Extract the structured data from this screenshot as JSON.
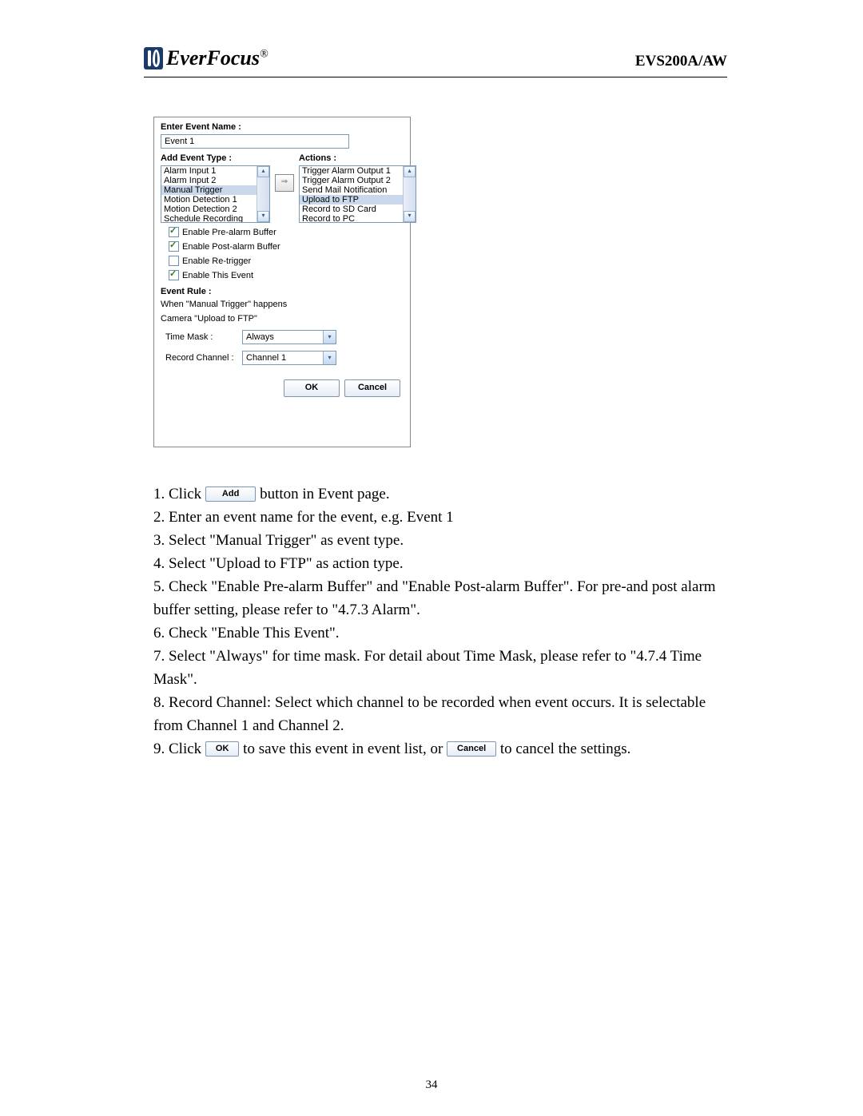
{
  "header": {
    "brand": "EverFocus",
    "reg": "®",
    "model": "EVS200A/AW"
  },
  "dialog": {
    "eventNameLabel": "Enter Event Name :",
    "eventNameValue": "Event 1",
    "addEventTypeLabel": "Add Event Type :",
    "actionsLabel": "Actions :",
    "eventTypes": [
      "Alarm Input 1",
      "Alarm Input 2",
      "Manual Trigger",
      "Motion Detection 1",
      "Motion Detection 2",
      "Schedule Recording"
    ],
    "eventTypeSelectedIdx": 2,
    "actions": [
      "Trigger Alarm Output 1",
      "Trigger Alarm Output 2",
      "Send Mail Notification",
      "Upload to FTP",
      "Record to SD Card",
      "Record to PC"
    ],
    "actionSelectedIdx": 3,
    "arrowLabel": "⇒",
    "checks": {
      "preAlarm": {
        "label": "Enable Pre-alarm Buffer",
        "checked": true
      },
      "postAlarm": {
        "label": "Enable Post-alarm Buffer",
        "checked": true
      },
      "retrigger": {
        "label": "Enable Re-trigger",
        "checked": false
      },
      "thisEvent": {
        "label": "Enable This Event",
        "checked": true
      }
    },
    "ruleLabel": "Event Rule :",
    "ruleLine1": "When \"Manual Trigger\" happens",
    "ruleLine2": "Camera \"Upload to FTP\"",
    "timeMaskLabel": "Time Mask :",
    "timeMaskValue": "Always",
    "recordChannelLabel": "Record Channel :",
    "recordChannelValue": "Channel 1",
    "okLabel": "OK",
    "cancelLabel": "Cancel"
  },
  "instructions": {
    "i1a": "1. Click ",
    "addBtn": "Add",
    "i1b": " button in Event page.",
    "i2": "2. Enter an event name for the event, e.g. Event 1",
    "i3": "3. Select \"Manual Trigger\" as event type.",
    "i4": "4. Select \"Upload to FTP\" as action type.",
    "i5": "5. Check \"Enable Pre-alarm Buffer\" and \"Enable Post-alarm Buffer\". For pre-and post alarm buffer setting, please refer to \"4.7.3 Alarm\".",
    "i6": "6. Check \"Enable This Event\".",
    "i7": "7. Select \"Always\" for time mask. For detail about Time Mask, please refer to \"4.7.4 Time Mask\".",
    "i8": "8. Record Channel: Select which channel to be recorded when event occurs. It is selectable from Channel 1 and Channel 2.",
    "i9a": "9. Click ",
    "okBtn": "OK",
    "i9b": " to save this event in event list, or ",
    "cancelBtn": "Cancel",
    "i9c": " to cancel the settings."
  },
  "pageNumber": "34"
}
